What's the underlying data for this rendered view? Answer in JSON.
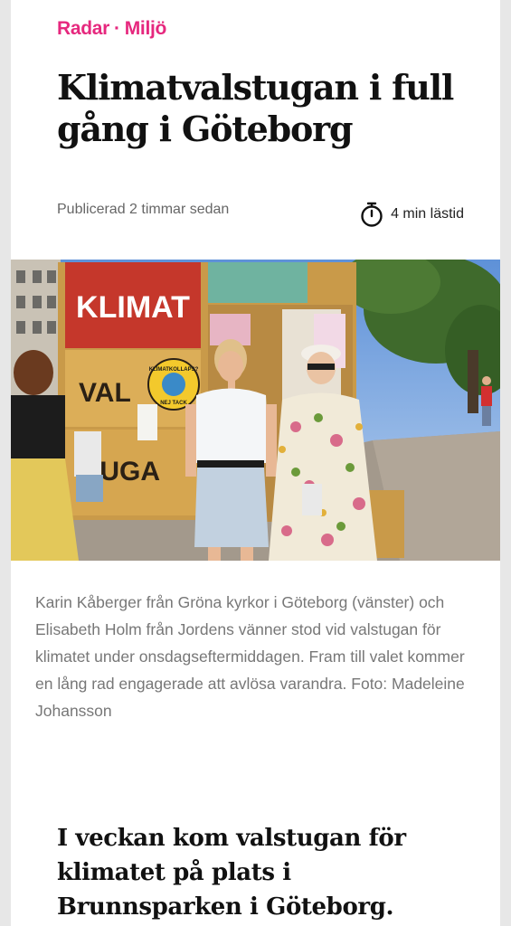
{
  "article": {
    "section": "Radar",
    "separator": "·",
    "category": "Miljö",
    "title": "Klimatvalstugan i full gång i Göteborg",
    "published": "Publicerad 2 timmar sedan",
    "read_time": "4 min lästid",
    "photo": {
      "sign_top": "KLIMAT",
      "sign_mid": "VAL",
      "sign_bottom": "TUGA",
      "badge_top": "KLIMATKOLLAPS?",
      "badge_bottom": "NEJ TACK"
    },
    "caption": "Karin Kåberger från Gröna kyrkor i Göteborg (vänster) och Elisabeth Holm från Jordens vänner stod vid valstugan för klimatet under onsdagseftermiddagen. Fram till valet kommer en lång rad engagerade att avlösa varandra. Foto: Madeleine Johansson",
    "lead": "I veckan kom valstugan för klimatet på plats i Brunnsparken i Göteborg."
  },
  "colors": {
    "accent": "#e6287e",
    "sign_red": "#c5372b",
    "hut_wood": "#d9a94e"
  },
  "icons": {
    "read_time": "stopwatch-icon"
  }
}
